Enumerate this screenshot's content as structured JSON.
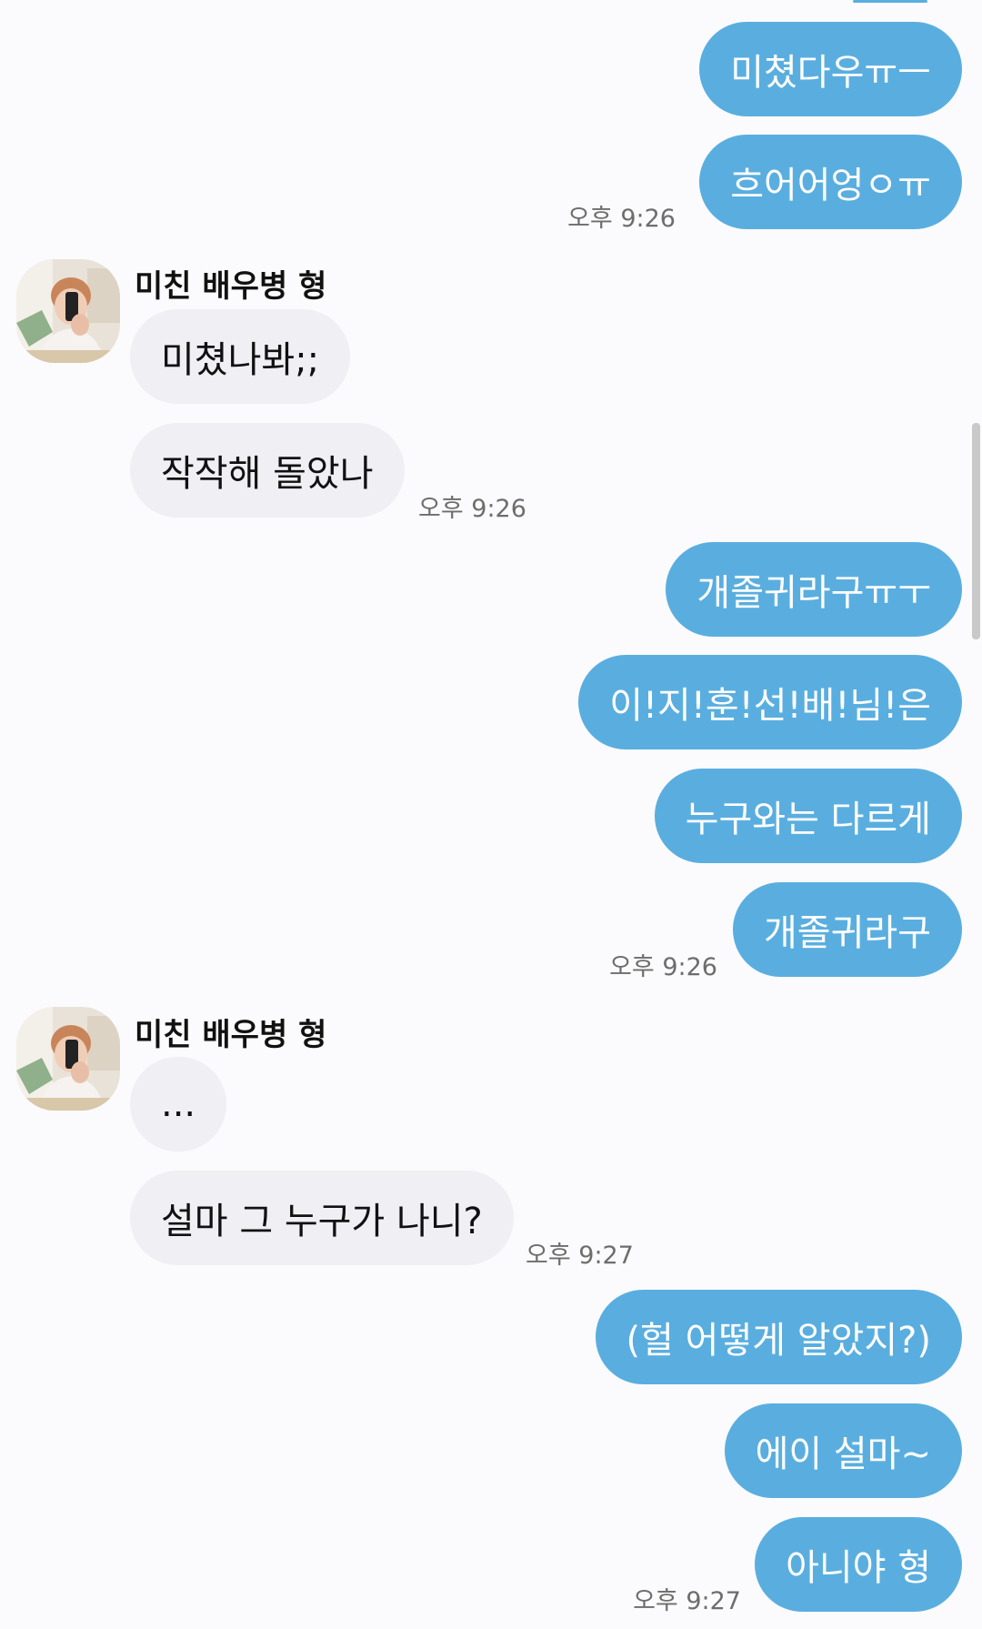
{
  "contact": {
    "name": "미친 배우병 형"
  },
  "messages": {
    "m1": "미쳤다우ㅠㅡ",
    "m2": "흐어어엉ㅇㅠ",
    "t1": "오후 9:26",
    "m3": "미쳤나봐;;",
    "m4": "작작해 돌았나",
    "t2": "오후 9:26",
    "m5": "개졸귀라구ㅠㅜ",
    "m6": "이!지!훈!선!배!님!은",
    "m7": "누구와는 다르게",
    "m8": "개졸귀라구",
    "t3": "오후 9:26",
    "m9": "...",
    "m10": "설마 그 누구가 나니?",
    "t4": "오후 9:27",
    "m11": "(헐 어떻게 알았지?)",
    "m12": "에이 설마~",
    "m13": "아니야 형",
    "t5": "오후 9:27"
  },
  "colors": {
    "sent_bubble": "#5aaedf",
    "received_bubble": "#efeff4",
    "background": "#fbfbfd"
  }
}
